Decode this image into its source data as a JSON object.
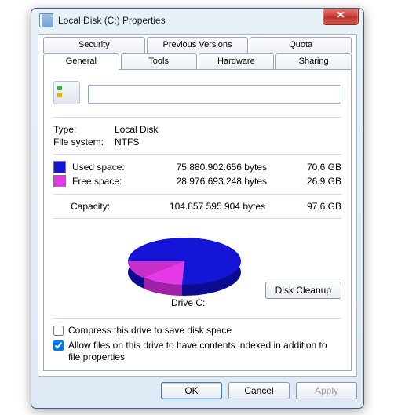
{
  "window": {
    "title": "Local Disk (C:) Properties",
    "close_glyph": "✕"
  },
  "tabs": {
    "back": [
      "Security",
      "Previous Versions",
      "Quota"
    ],
    "front": [
      "General",
      "Tools",
      "Hardware",
      "Sharing"
    ]
  },
  "general": {
    "label_value": "",
    "type": {
      "label": "Type:",
      "value": "Local Disk"
    },
    "fs": {
      "label": "File system:",
      "value": "NTFS"
    },
    "used": {
      "label": "Used space:",
      "bytes": "75.880.902.656 bytes",
      "hr": "70,6 GB"
    },
    "free": {
      "label": "Free space:",
      "bytes": "28.976.693.248 bytes",
      "hr": "26,9 GB"
    },
    "cap": {
      "label": "Capacity:",
      "bytes": "104.857.595.904 bytes",
      "hr": "97,6 GB"
    },
    "drive_label": "Drive C:",
    "cleanup_btn": "Disk Cleanup",
    "compress": "Compress this drive to save disk space",
    "index": "Allow files on this drive to have contents indexed in addition to file properties"
  },
  "buttons": {
    "ok": "OK",
    "cancel": "Cancel",
    "apply": "Apply"
  },
  "colors": {
    "used": "#1515d8",
    "free": "#e63ae6"
  },
  "chart_data": {
    "type": "pie",
    "title": "Drive C:",
    "series": [
      {
        "name": "Used space",
        "value": 70.6,
        "unit": "GB",
        "color": "#1515d8"
      },
      {
        "name": "Free space",
        "value": 26.9,
        "unit": "GB",
        "color": "#e63ae6"
      }
    ]
  }
}
